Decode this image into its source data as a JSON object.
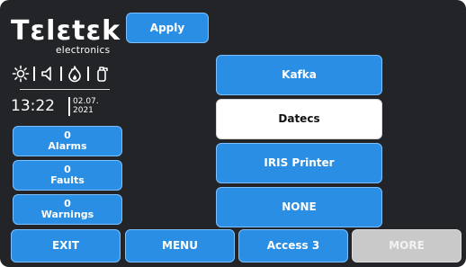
{
  "header": {
    "apply_label": "Apply"
  },
  "logo": {
    "brand": "Tεlεtεk",
    "sub": "electronics"
  },
  "status": {
    "icons": [
      "sun-icon",
      "speaker-icon",
      "fire-icon",
      "extinguisher-icon"
    ],
    "time": "13:22",
    "date_line1": "02.07.",
    "date_line2": "2021"
  },
  "counters": [
    {
      "count": "0",
      "label": "Alarms"
    },
    {
      "count": "0",
      "label": "Faults"
    },
    {
      "count": "0",
      "label": "Warnings"
    }
  ],
  "options": [
    {
      "label": "Kafka",
      "selected": false
    },
    {
      "label": "Datecs",
      "selected": true
    },
    {
      "label": "IRIS Printer",
      "selected": false
    },
    {
      "label": "NONE",
      "selected": false
    }
  ],
  "bottom_bar": {
    "exit_label": "EXIT",
    "menu_label": "MENU",
    "access_label": "Access 3",
    "more_label": "MORE"
  },
  "colors": {
    "background": "#222427",
    "button": "#2a8fe4",
    "selected": "#ffffff",
    "disabled": "#c9c9c9"
  }
}
